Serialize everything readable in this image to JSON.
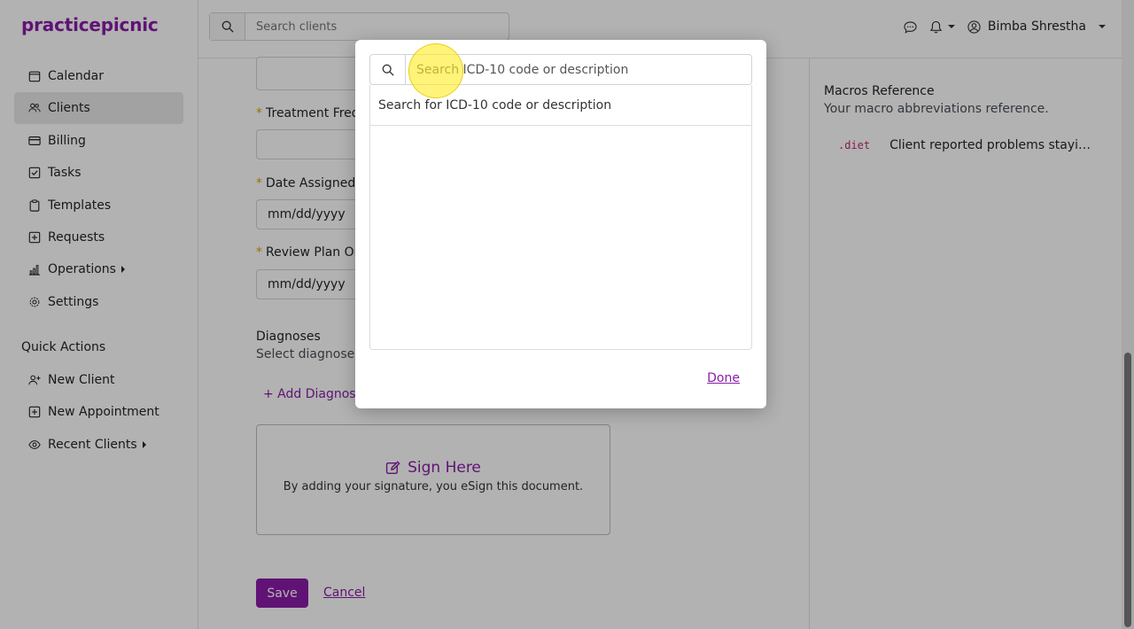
{
  "brand": {
    "name": "practicepicnic",
    "color": "#8a1ca8"
  },
  "sidebar": {
    "items": [
      {
        "label": "Calendar",
        "icon": "calendar-icon"
      },
      {
        "label": "Clients",
        "icon": "users-icon",
        "active": true
      },
      {
        "label": "Billing",
        "icon": "credit-card-icon"
      },
      {
        "label": "Tasks",
        "icon": "checkbox-icon"
      },
      {
        "label": "Templates",
        "icon": "clipboard-icon"
      },
      {
        "label": "Requests",
        "icon": "plus-square-icon"
      },
      {
        "label": "Operations",
        "icon": "bar-chart-icon",
        "has_submenu": true
      },
      {
        "label": "Settings",
        "icon": "gear-icon"
      }
    ],
    "quick_actions_title": "Quick Actions",
    "quick_actions": [
      {
        "label": "New Client",
        "icon": "person-add-icon"
      },
      {
        "label": "New Appointment",
        "icon": "plus-square-icon"
      },
      {
        "label": "Recent Clients",
        "icon": "eye-icon",
        "has_submenu": true
      }
    ]
  },
  "header": {
    "search_placeholder": "Search clients",
    "user_name": "Bimba Shrestha"
  },
  "form": {
    "treatment_frequency_label": "Treatment Freq",
    "date_assigned_label": "Date Assigned t",
    "date_assigned_value": "mm/dd/yyyy",
    "review_plan_label": "Review Plan On",
    "review_plan_value": "mm/dd/yyyy",
    "diagnoses_title": "Diagnoses",
    "diagnoses_sub": "Select diagnoses",
    "add_diagnosis": "+ Add Diagnosis",
    "sign_title": "Sign Here",
    "sign_sub": "By adding your signature, you eSign this document.",
    "save_label": "Save",
    "cancel_label": "Cancel"
  },
  "macros": {
    "title": "Macros Reference",
    "subtitle": "Your macro abbreviations reference.",
    "items": [
      {
        "key": ".diet",
        "value": "Client reported problems stayi…"
      }
    ]
  },
  "modal": {
    "search_placeholder": "Search ICD-10 code or description",
    "hint": "Search for ICD-10 code or description",
    "done_label": "Done"
  }
}
